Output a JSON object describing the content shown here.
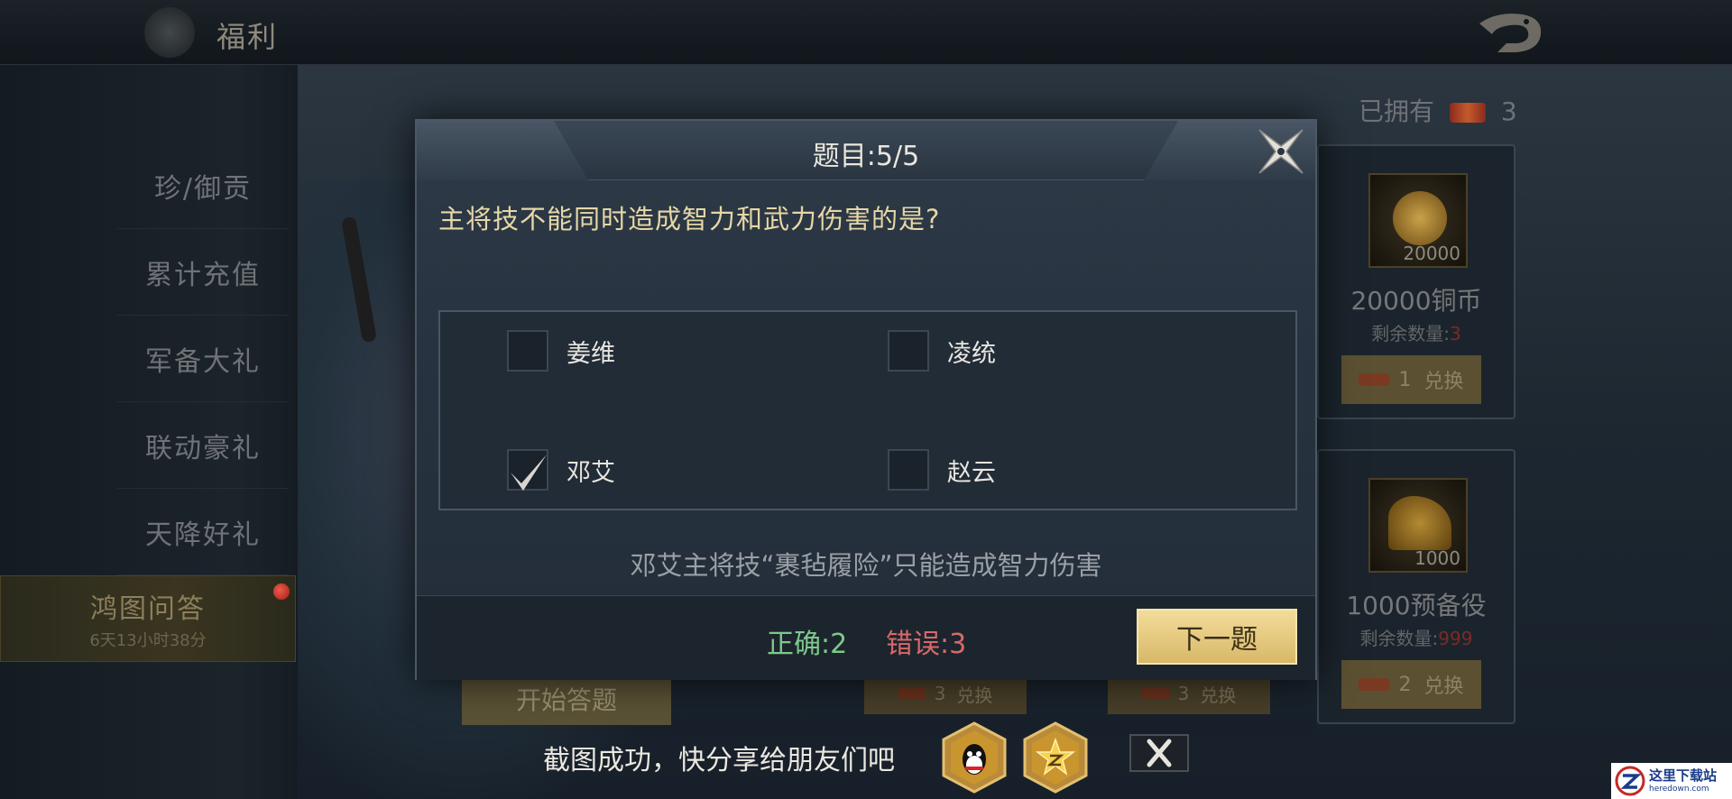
{
  "header": {
    "title": "福利"
  },
  "sidebar": {
    "items": [
      {
        "label": "珍/御贡"
      },
      {
        "label": "累计充值"
      },
      {
        "label": "军备大礼"
      },
      {
        "label": "联动豪礼"
      },
      {
        "label": "天降好礼"
      },
      {
        "label": "鸿图问答",
        "timer": "6天13小时38分",
        "active": true
      }
    ]
  },
  "shop": {
    "owned_label": "已拥有",
    "owned_count": "3",
    "items": [
      {
        "thumb_qty": "20000",
        "name": "20000铜币",
        "remain_label": "剩余数量:",
        "remain_value": "3",
        "cost": "1",
        "exchange_label": "兑换",
        "icon": "copper-coin-icon"
      },
      {
        "thumb_qty": "1000",
        "name": "1000预备役",
        "remain_label": "剩余数量:",
        "remain_value": "999",
        "cost": "2",
        "exchange_label": "兑换",
        "icon": "helmet-icon"
      }
    ],
    "hidden_exchange": [
      {
        "cost": "3",
        "label": "兑换"
      },
      {
        "cost": "3",
        "label": "兑换"
      }
    ],
    "start_button_label": "开始答题"
  },
  "quiz": {
    "counter": "题目:5/5",
    "question": "主将技不能同时造成智力和武力伤害的是?",
    "options": [
      {
        "label": "姜维",
        "checked": false
      },
      {
        "label": "凌统",
        "checked": false
      },
      {
        "label": "邓艾",
        "checked": true
      },
      {
        "label": "赵云",
        "checked": false
      }
    ],
    "explanation": "邓艾主将技“裹毡履险”只能造成智力伤害",
    "correct_label": "正确:2",
    "wrong_label": "错误:3",
    "next_button_label": "下一题",
    "colors": {
      "correct": "#7ec98b",
      "wrong": "#d8696a",
      "question": "#e6d7a6",
      "button": "#e8c97e"
    }
  },
  "share": {
    "message": "截图成功，快分享给朋友们吧",
    "buttons": [
      {
        "icon": "qq-icon"
      },
      {
        "icon": "qzone-icon"
      }
    ],
    "close_icon": "close-icon"
  },
  "watermark": {
    "cn": "这里下载站",
    "en": "heredown.com"
  }
}
